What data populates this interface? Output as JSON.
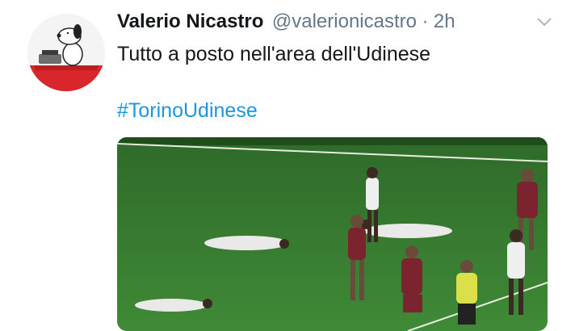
{
  "tweet": {
    "author_name": "Valerio Nicastro",
    "handle": "@valerionicastro",
    "separator": "·",
    "time": "2h",
    "text": "Tutto a posto nell'area dell'Udinese",
    "hashtag": "#TorinoUdinese",
    "icons": {
      "avatar": "snoopy-avatar",
      "caret": "chevron-down-icon"
    },
    "colors": {
      "link": "#1b95e0",
      "secondary_text": "#657786",
      "primary_text": "#14171a"
    }
  }
}
